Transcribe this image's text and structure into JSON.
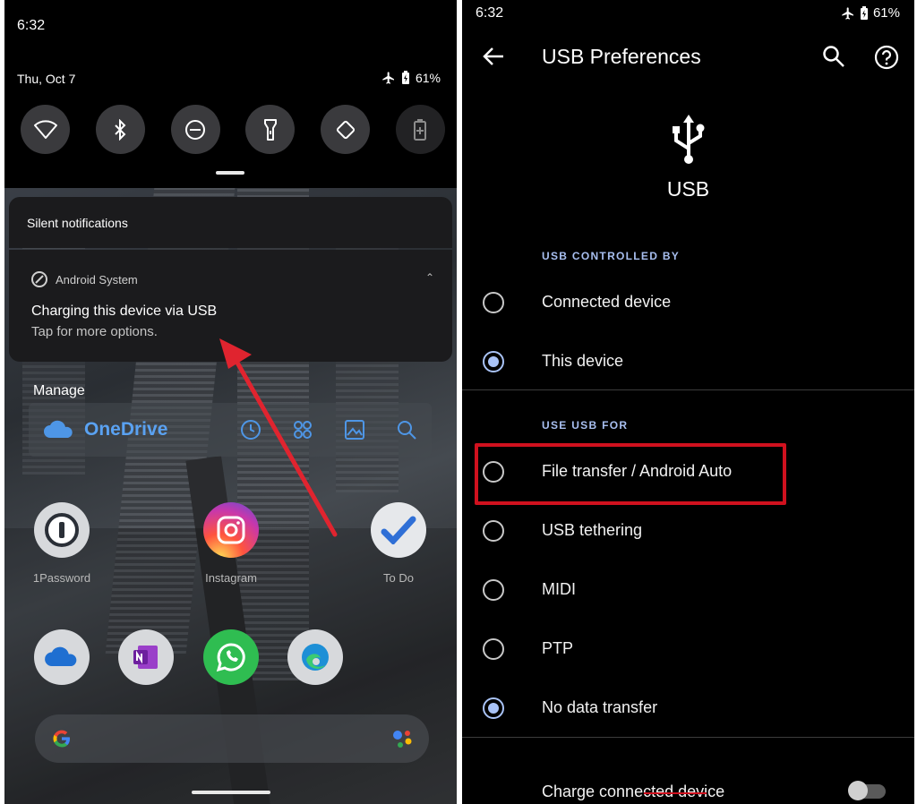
{
  "left": {
    "status": {
      "time": "6:32",
      "date": "Thu, Oct 7",
      "battery": "61%"
    },
    "quick_settings": [
      {
        "name": "wifi-icon"
      },
      {
        "name": "bluetooth-icon"
      },
      {
        "name": "do-not-disturb-icon"
      },
      {
        "name": "flashlight-icon"
      },
      {
        "name": "auto-rotate-icon"
      },
      {
        "name": "battery-saver-icon"
      }
    ],
    "notifications": {
      "header": "Silent notifications",
      "app": "Android System",
      "title": "Charging this device via USB",
      "subtitle": "Tap for more options."
    },
    "manage_label": "Manage",
    "widget": {
      "name": "OneDrive"
    },
    "apps": {
      "onepassword": "1Password",
      "instagram": "Instagram",
      "todo": "To Do"
    },
    "annotation_color": "#e0242f"
  },
  "right": {
    "status": {
      "time": "6:32",
      "battery": "61%"
    },
    "title": "USB Preferences",
    "usb_label": "USB",
    "section_controlled": "USB CONTROLLED BY",
    "controlled_options": [
      {
        "label": "Connected device",
        "selected": false
      },
      {
        "label": "This device",
        "selected": true
      }
    ],
    "section_use": "USE USB FOR",
    "use_options": [
      {
        "label": "File transfer / Android Auto",
        "selected": false
      },
      {
        "label": "USB tethering",
        "selected": false
      },
      {
        "label": "MIDI",
        "selected": false
      },
      {
        "label": "PTP",
        "selected": false
      },
      {
        "label": "No data transfer",
        "selected": true
      }
    ],
    "charge_label": "Charge connected device",
    "charge_enabled": false,
    "accent_color": "#a9c3f7",
    "highlight_color": "#d0111e"
  }
}
